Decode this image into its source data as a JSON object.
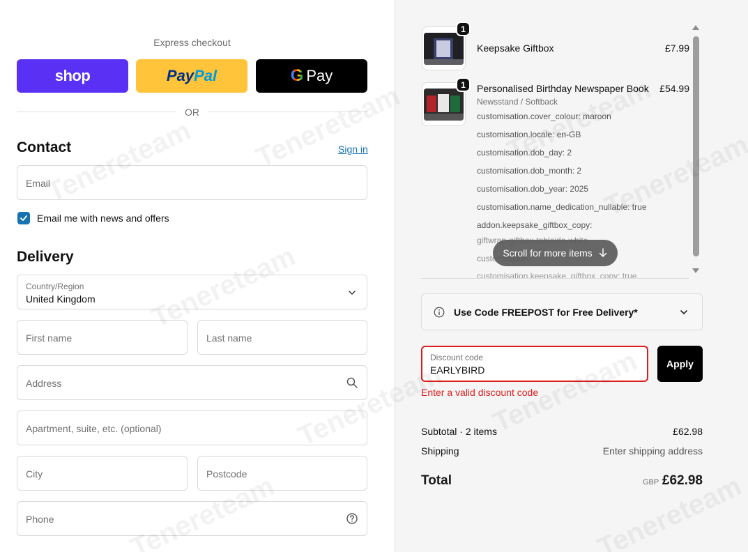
{
  "express": {
    "title": "Express checkout",
    "shop_label": "shop",
    "paypal_label_1": "Pay",
    "paypal_label_2": "Pal",
    "gpay_g": "G",
    "gpay_label": "Pay",
    "or_label": "OR"
  },
  "contact": {
    "title": "Contact",
    "signin_label": "Sign in",
    "email_placeholder": "Email",
    "newsletter_label": "Email me with news and offers",
    "newsletter_checked": true
  },
  "delivery": {
    "title": "Delivery",
    "country_label": "Country/Region",
    "country_value": "United Kingdom",
    "first_name_placeholder": "First name",
    "last_name_placeholder": "Last name",
    "address_placeholder": "Address",
    "apartment_placeholder": "Apartment, suite, etc. (optional)",
    "city_placeholder": "City",
    "postcode_placeholder": "Postcode",
    "phone_placeholder": "Phone"
  },
  "order": {
    "items": [
      {
        "name": "Keepsake Giftbox",
        "price": "£7.99",
        "quantity": "1"
      },
      {
        "name": "Personalised Birthday Newspaper Book",
        "price": "£54.99",
        "quantity": "1",
        "variant": "Newsstand / Softback",
        "properties": [
          "customisation.cover_colour: maroon",
          "customisation.locale: en-GB",
          "customisation.dob_day: 2",
          "customisation.dob_month: 2",
          "customisation.dob_year: 2025",
          "customisation.name_dedication_nullable: true",
          "addon.keepsake_giftbox_copy:",
          "giftwrap-giftbox-tablaido-white",
          "customisation.",
          "customisation.keepsake_giftbox_copy: true"
        ]
      }
    ],
    "scroll_hint": "Scroll for more items",
    "promo_text": "Use Code FREEPOST for Free Delivery*"
  },
  "discount": {
    "label": "Discount code",
    "value": "EARLYBIRD",
    "apply_label": "Apply",
    "error": "Enter a valid discount code"
  },
  "summary": {
    "subtotal_label": "Subtotal · 2 items",
    "subtotal_value": "£62.98",
    "shipping_label": "Shipping",
    "shipping_value": "Enter shipping address",
    "total_label": "Total",
    "currency": "GBP",
    "total_value": "£62.98"
  },
  "watermark": "Tenereteam",
  "colors": {
    "shop": "#5a31f4",
    "paypal": "#ffc439",
    "link": "#1773b0",
    "error": "#dd1d1d"
  }
}
